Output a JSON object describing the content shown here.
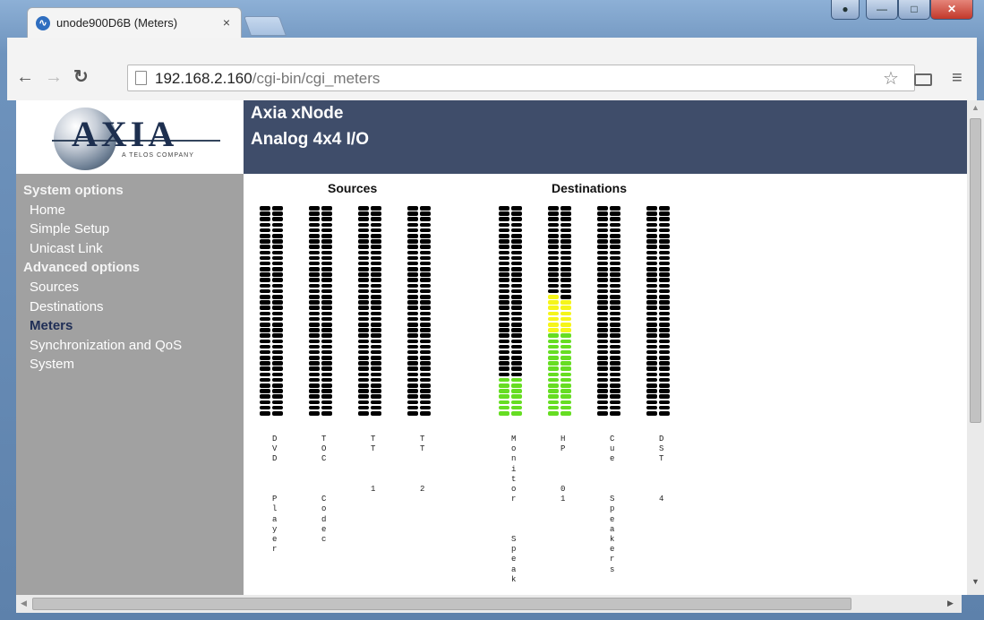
{
  "browser": {
    "tab_title": "unode900D6B (Meters)",
    "tab_close": "×",
    "url_host": "192.168.2.160",
    "url_path": "/cgi-bin/cgi_meters",
    "favicon": "∿"
  },
  "page": {
    "logo_text": "AXIA",
    "logo_tag": "A TELOS COMPANY",
    "title_line1": "Axia xNode",
    "title_line2": "Analog 4x4 I/O"
  },
  "sidebar": {
    "items": [
      {
        "label": "System options",
        "kind": "section"
      },
      {
        "label": "Home",
        "kind": "link"
      },
      {
        "label": "Simple Setup",
        "kind": "link"
      },
      {
        "label": "Unicast Link",
        "kind": "link"
      },
      {
        "label": "Advanced options",
        "kind": "section"
      },
      {
        "label": "Sources",
        "kind": "link"
      },
      {
        "label": "Destinations",
        "kind": "link"
      },
      {
        "label": "Meters",
        "kind": "active"
      },
      {
        "label": "Synchronization and QoS",
        "kind": "link"
      },
      {
        "label": "System",
        "kind": "link"
      }
    ]
  },
  "meters": {
    "segments_per_bar": 38,
    "colors": {
      "off": "#000000",
      "green": "#66dd22",
      "yellow": "#f5f51a"
    },
    "groups": [
      {
        "title": "Sources",
        "channels": [
          {
            "label": "DVD\n\nPlayer",
            "bars": [
              {
                "green": 0,
                "yellow": 0
              },
              {
                "green": 0,
                "yellow": 0
              }
            ]
          },
          {
            "label": "TOC\n\nCodec",
            "bars": [
              {
                "green": 0,
                "yellow": 0
              },
              {
                "green": 0,
                "yellow": 0
              }
            ]
          },
          {
            "label": "TT\n\n1",
            "bars": [
              {
                "green": 0,
                "yellow": 0
              },
              {
                "green": 0,
                "yellow": 0
              }
            ]
          },
          {
            "label": "TT\n\n2",
            "bars": [
              {
                "green": 0,
                "yellow": 0
              },
              {
                "green": 0,
                "yellow": 0
              }
            ]
          }
        ]
      },
      {
        "title": "Destinations",
        "channels": [
          {
            "label": "Monitor\n\nSpeak",
            "bars": [
              {
                "green": 7,
                "yellow": 0
              },
              {
                "green": 7,
                "yellow": 0
              }
            ]
          },
          {
            "label": "HP\n\n01",
            "bars": [
              {
                "green": 15,
                "yellow": 7
              },
              {
                "green": 15,
                "yellow": 6
              }
            ]
          },
          {
            "label": "Cue\n\nSpeakers",
            "bars": [
              {
                "green": 0,
                "yellow": 0
              },
              {
                "green": 0,
                "yellow": 0
              }
            ]
          },
          {
            "label": "DST\n\n4",
            "bars": [
              {
                "green": 0,
                "yellow": 0
              },
              {
                "green": 0,
                "yellow": 0
              }
            ]
          }
        ]
      }
    ]
  }
}
